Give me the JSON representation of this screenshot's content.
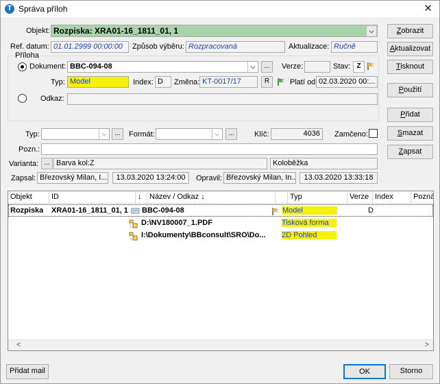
{
  "window": {
    "title": "Správa příloh",
    "close_glyph": "✕"
  },
  "objekt": {
    "label": "Objekt:",
    "value": "Rozpiska: XRA01-16_1811_01, 1"
  },
  "ref_datum": {
    "label": "Ref. datum:",
    "value": "01.01.2999 00:00:00"
  },
  "zpusob": {
    "label": "Způsob výběru:",
    "value": "Rozpracovaná"
  },
  "aktualizace": {
    "label": "Aktualizace:",
    "value": "Ručně"
  },
  "priloha": {
    "group_label": "Příloha",
    "dokument_label": "Dokument:",
    "dokument_value": "BBC-094-08",
    "verze_label": "Verze:",
    "verze_value": "",
    "stav_label": "Stav:",
    "stav_value": "Z",
    "typ_label": "Typ:",
    "typ_value": "Model",
    "index_label": "Index:",
    "index_value": "D",
    "zmena_label": "Změna:",
    "zmena_value": "KT-0017/17",
    "r_button": "R",
    "plati_label": "Platí od:",
    "plati_value": "02.03.2020 00:...",
    "odkaz_label": "Odkaz:",
    "odkaz_value": ""
  },
  "filters": {
    "typ_label": "Typ:",
    "format_label": "Formát:",
    "klic_label": "Klíč:",
    "klic_value": "4036",
    "zamceno_label": "Zamčeno:",
    "pozn_label": "Pozn.:",
    "varianta_label": "Varianta:",
    "varianta_value": "Barva kol:Z",
    "varianta_value2": "Koloběžka",
    "zapsal_label": "Zapsal:",
    "zapsal_value": "Březovský Milan, I...",
    "zapsal_date": "13.03.2020 13:24:00",
    "opravil_label": "Opravil:",
    "opravil_value": "Březovský Milan, In...",
    "opravil_date": "13.03.2020 13:33:18"
  },
  "buttons": {
    "zobrazit": "Zobrazit",
    "aktualizovat": "Aktualizovat",
    "tisknout": "Tisknout",
    "pouziti": "Použití",
    "pridat": "Přidat",
    "smazat": "Smazat",
    "zapsat": "Zapsat",
    "pridat_mail": "Přidat mail",
    "ok": "OK",
    "storno": "Storno",
    "ellipsis": "..."
  },
  "table": {
    "headers": [
      "Objekt",
      "ID",
      "↓",
      "Název / Odkaz ↓",
      "",
      "Typ",
      "Verze",
      "Index",
      "Poznám"
    ],
    "rows": [
      {
        "objekt": "Rozpiska",
        "id": "XRA01-16_1811_01, 1",
        "nazev": "BBC-094-08",
        "typ": "Model",
        "verze": "",
        "index": "D"
      },
      {
        "objekt": "",
        "id": "",
        "nazev": "D:\\NV180007_1.PDF",
        "typ": "Tisková forma",
        "verze": "",
        "index": ""
      },
      {
        "objekt": "",
        "id": "",
        "nazev": "I:\\Dokumenty\\BBconsult\\SRO\\Do...",
        "typ": "2D Pohled",
        "verze": "",
        "index": ""
      }
    ],
    "scroll_left": "<",
    "scroll_right": ">"
  },
  "colors": {
    "highlight": "#f5f10a",
    "objekt_bg": "#a9d4a9",
    "blue_text": "#1f3fb5",
    "ok_border": "#0078d7"
  }
}
